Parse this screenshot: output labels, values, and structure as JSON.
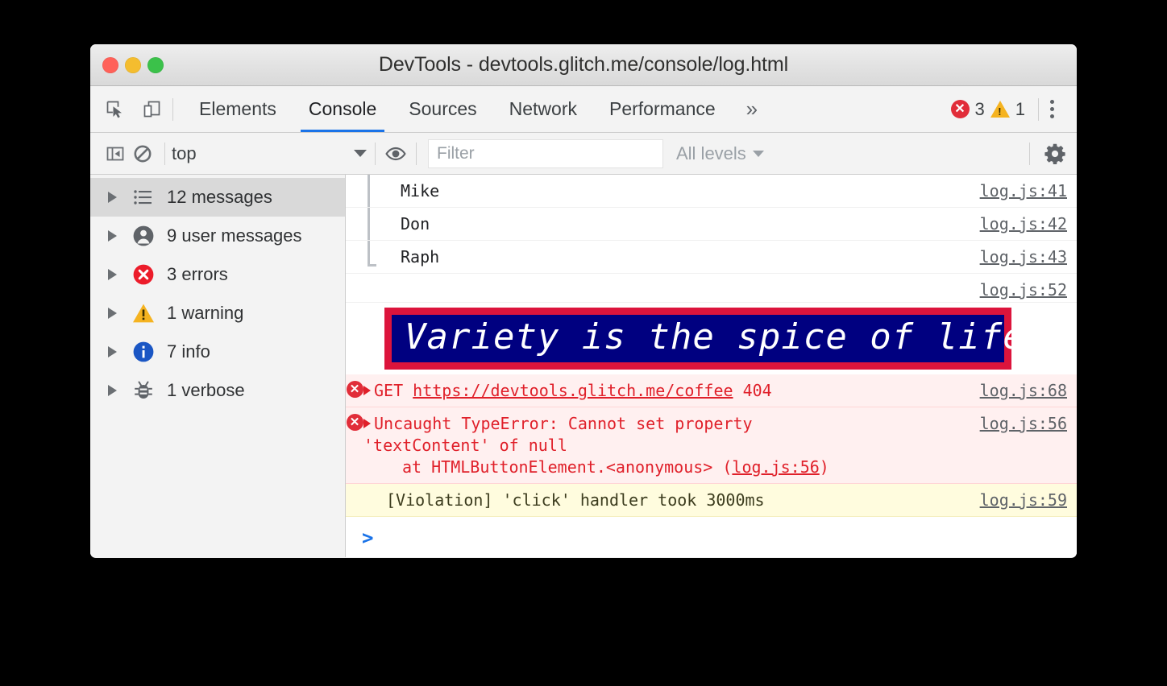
{
  "window": {
    "title": "DevTools - devtools.glitch.me/console/log.html",
    "traffic_lights": [
      "close",
      "minimize",
      "zoom"
    ]
  },
  "tabbar": {
    "inspect_icon": "inspect-element-icon",
    "device_icon": "device-toolbar-icon",
    "tabs": [
      {
        "label": "Elements",
        "active": false
      },
      {
        "label": "Console",
        "active": true
      },
      {
        "label": "Sources",
        "active": false
      },
      {
        "label": "Network",
        "active": false
      },
      {
        "label": "Performance",
        "active": false
      }
    ],
    "more_tabs_label": "»",
    "error_count": "3",
    "warning_count": "1",
    "menu_icon": "kebab-menu-icon"
  },
  "filterbar": {
    "sidebar_toggle_icon": "show-console-sidebar-icon",
    "clear_icon": "clear-console-icon",
    "context": "top",
    "eye_icon": "live-expression-icon",
    "filter_placeholder": "Filter",
    "filter_value": "",
    "levels_label": "All levels",
    "settings_icon": "gear-icon"
  },
  "sidebar": {
    "items": [
      {
        "label": "12 messages",
        "icon": "list-icon",
        "selected": true
      },
      {
        "label": "9 user messages",
        "icon": "person-icon",
        "selected": false
      },
      {
        "label": "3 errors",
        "icon": "error-icon",
        "selected": false
      },
      {
        "label": "1 warning",
        "icon": "warning-icon",
        "selected": false
      },
      {
        "label": "7 info",
        "icon": "info-icon",
        "selected": false
      },
      {
        "label": "1 verbose",
        "icon": "bug-icon",
        "selected": false
      }
    ]
  },
  "console": {
    "rows": [
      {
        "text": "Mike",
        "source": "log.js:41",
        "type": "log",
        "grouped": true
      },
      {
        "text": "Don",
        "source": "log.js:42",
        "type": "log",
        "grouped": true
      },
      {
        "text": "Raph",
        "source": "log.js:43",
        "type": "log",
        "grouped": true
      },
      {
        "text": "",
        "source": "log.js:52",
        "type": "blank",
        "grouped": false
      }
    ],
    "banner": {
      "text": "Variety is the spice of life",
      "border_color": "#dc143c",
      "background_color": "#000080",
      "text_color": "#ffffff"
    },
    "error_network": {
      "method": "GET",
      "url": "https://devtools.glitch.me/coffee",
      "status": "404",
      "source": "log.js:68"
    },
    "error_exception": {
      "line1": "Uncaught TypeError: Cannot set property",
      "line2": "'textContent' of null",
      "line3_prefix": "at HTMLButtonElement.<anonymous> (",
      "line3_link": "log.js:56",
      "line3_suffix": ")",
      "source": "log.js:56"
    },
    "violation": {
      "text": "[Violation] 'click' handler took 3000ms",
      "source": "log.js:59"
    },
    "prompt_chevron": ">",
    "prompt_value": ""
  },
  "colors": {
    "accent_blue": "#1a73e8",
    "error_red": "#e12d39",
    "warning_yellow": "#f5b320",
    "info_blue": "#1a56c4",
    "error_row_bg": "#fff0f0",
    "warning_row_bg": "#fffcde"
  }
}
